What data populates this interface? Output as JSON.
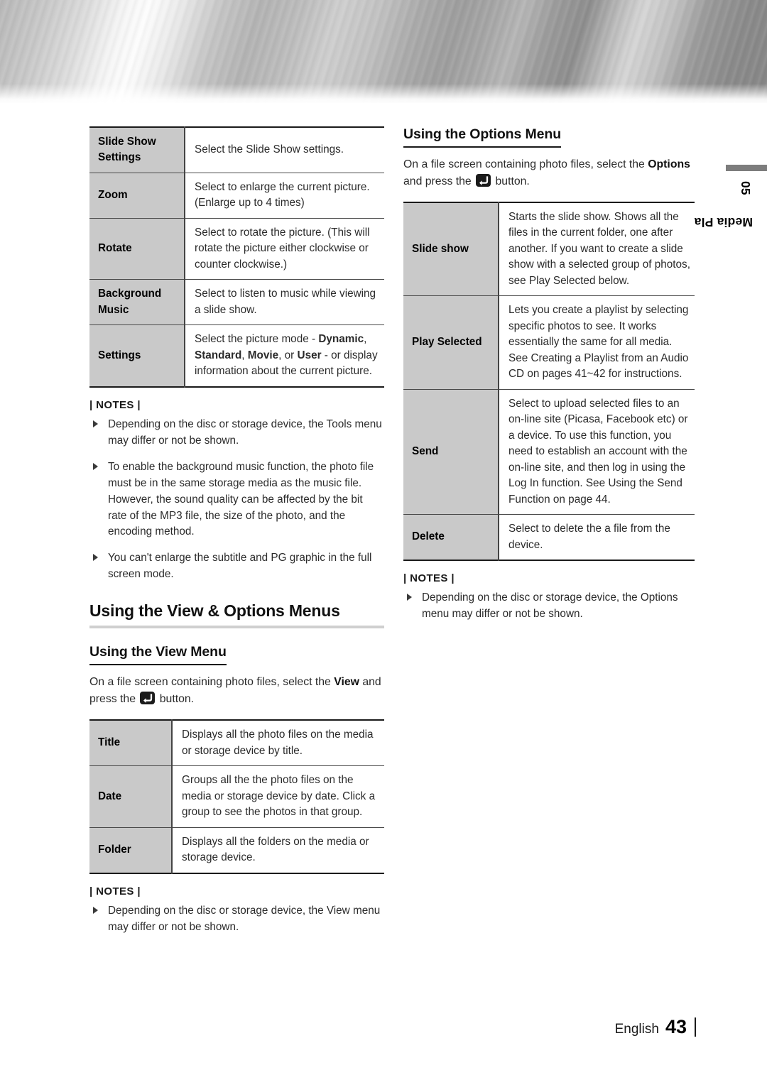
{
  "chapter_tab": {
    "number": "05",
    "label": "Media Play"
  },
  "footer": {
    "language": "English",
    "page_number": "43"
  },
  "left_column": {
    "tools_table": {
      "rows": [
        {
          "label": "Slide Show Settings",
          "value": "Select the Slide Show settings."
        },
        {
          "label": "Zoom",
          "value": "Select to enlarge the current picture. (Enlarge up to 4 times)"
        },
        {
          "label": "Rotate",
          "value": "Select to rotate the picture. (This will rotate the picture either clockwise or counter clockwise.)"
        },
        {
          "label": "Background Music",
          "value": "Select to listen to music while viewing a slide show."
        },
        {
          "label": "Settings",
          "value": "Select the picture mode - Dynamic, Standard, Movie, or User - or display information about the current picture."
        }
      ]
    },
    "notes_1": {
      "title": "| NOTES |",
      "items": [
        "Depending on the disc or storage device, the Tools menu may differ or not be shown.",
        "To enable the background music function, the photo file must be in the same storage media as the music file. However, the sound quality can be affected by the bit rate of the MP3 file, the size of the photo, and the encoding method.",
        "You can't enlarge the subtitle and PG graphic in the full screen mode."
      ]
    },
    "section_heading": "Using the View & Options Menus",
    "view_menu_heading": "Using the View Menu",
    "view_menu_intro_before": "On a file screen containing photo files, select the ",
    "view_menu_intro_bold": "View",
    "view_menu_intro_mid": " and press the ",
    "view_menu_intro_after": " button.",
    "view_table": {
      "rows": [
        {
          "label": "Title",
          "value": "Displays all the photo files on the media or storage device by title."
        },
        {
          "label": "Date",
          "value": "Groups all the the photo files on the media or storage device by date. Click a group to see the photos in that group."
        },
        {
          "label": "Folder",
          "value": "Displays all the folders on the media or storage device."
        }
      ]
    },
    "notes_2": {
      "title": "| NOTES |",
      "items": [
        "Depending on the disc or storage device, the View menu may differ or not be shown."
      ]
    }
  },
  "right_column": {
    "options_menu_heading": "Using the Options Menu",
    "options_intro_before": "On a file screen containing photo files, select the ",
    "options_intro_bold": "Options",
    "options_intro_mid": " and press the ",
    "options_intro_after": " button.",
    "options_table": {
      "rows": [
        {
          "label": "Slide show",
          "value": "Starts the slide show. Shows all the files in the current folder, one after another. If you want to create a slide show with a selected group of photos, see Play Selected below."
        },
        {
          "label": "Play Selected",
          "value": "Lets you create a playlist by selecting specific photos to see. It works essentially the same for all media. See Creating a Playlist from an Audio CD on pages 41~42 for instructions."
        },
        {
          "label": "Send",
          "value": "Select to upload selected files to an on-line site (Picasa, Facebook etc) or a device. To use this function, you need to establish an account with the on-line site, and then log in using the Log In function. See Using the Send Function on page 44."
        },
        {
          "label": "Delete",
          "value": "Select to delete the a file from the device."
        }
      ]
    },
    "notes": {
      "title": "| NOTES |",
      "items": [
        "Depending on the disc or storage device, the Options menu may differ or not be shown."
      ]
    }
  },
  "icons": {
    "enter_button": "enter-button-icon"
  }
}
